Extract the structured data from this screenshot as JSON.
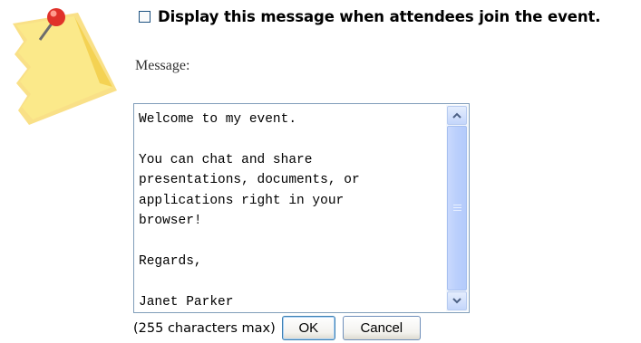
{
  "option": {
    "checked": false,
    "label": "Display this message when attendees join the event."
  },
  "message": {
    "label": "Message:",
    "value": "Welcome to my event.\n\nYou can chat and share\npresentations, documents, or\napplications right in your\nbrowser!\n\nRegards,\n\nJanet Parker"
  },
  "footer": {
    "limit_note": "(255 characters max)",
    "ok_label": "OK",
    "cancel_label": "Cancel"
  },
  "icons": {
    "illustration": "sticky-note-pin-icon",
    "scroll_up": "chevron-up-icon",
    "scroll_down": "chevron-down-icon"
  },
  "colors": {
    "note_yellow": "#fbe98a",
    "pin_red": "#e0322a",
    "scrollbar_blue": "#bdd0fb",
    "field_border": "#7f9db9"
  }
}
